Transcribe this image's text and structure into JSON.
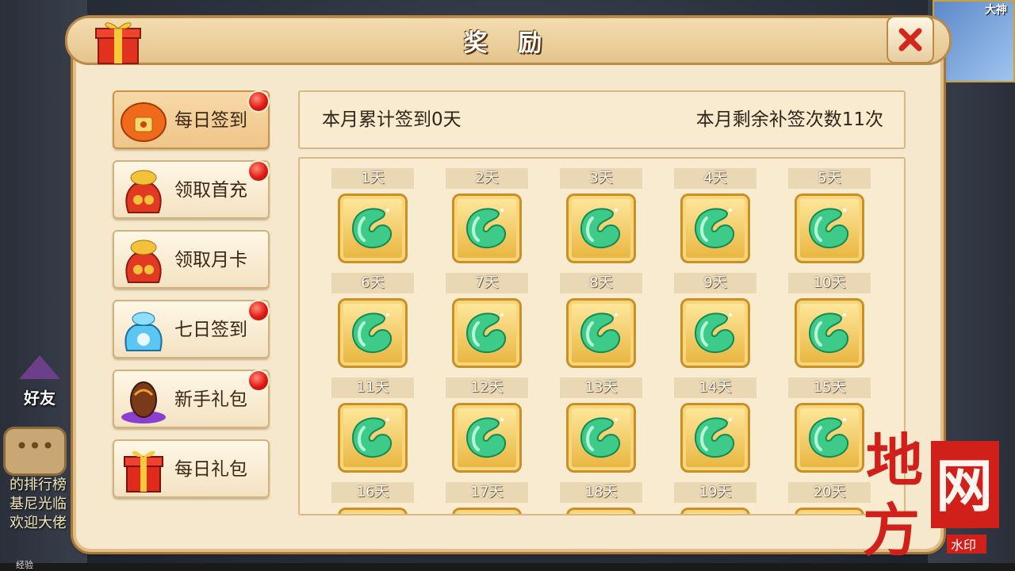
{
  "title": "奖 励",
  "menu": [
    {
      "label": "每日签到",
      "icon": "lantern-icon",
      "badge": true,
      "active": true
    },
    {
      "label": "领取首充",
      "icon": "money-bag-icon",
      "badge": true,
      "active": false
    },
    {
      "label": "领取月卡",
      "icon": "money-bag-icon",
      "badge": false,
      "active": false
    },
    {
      "label": "七日签到",
      "icon": "blue-bag-icon",
      "badge": true,
      "active": false
    },
    {
      "label": "新手礼包",
      "icon": "egg-icon",
      "badge": true,
      "active": false
    },
    {
      "label": "每日礼包",
      "icon": "gift-box-icon",
      "badge": false,
      "active": false
    }
  ],
  "info": {
    "signed": "本月累计签到0天",
    "makeup": "本月剩余补签次数11次"
  },
  "days": [
    "1天",
    "2天",
    "3天",
    "4天",
    "5天",
    "6天",
    "7天",
    "8天",
    "9天",
    "10天",
    "11天",
    "12天",
    "13天",
    "14天",
    "15天",
    "16天",
    "17天",
    "18天",
    "19天",
    "20天"
  ],
  "reward_icon": "jade-icon",
  "background": {
    "friend_label": "好友",
    "chat_lines": [
      "的排行榜",
      "基尼光临",
      "欢迎大佬"
    ],
    "exp_label": "经验",
    "avatar_name": "大神"
  },
  "watermark": {
    "top": "地",
    "mid": "网",
    "bottom": "方",
    "tag": "水印"
  },
  "colors": {
    "panel": "#f6e8cc",
    "accent": "#c99028",
    "badge": "#e01a14"
  }
}
